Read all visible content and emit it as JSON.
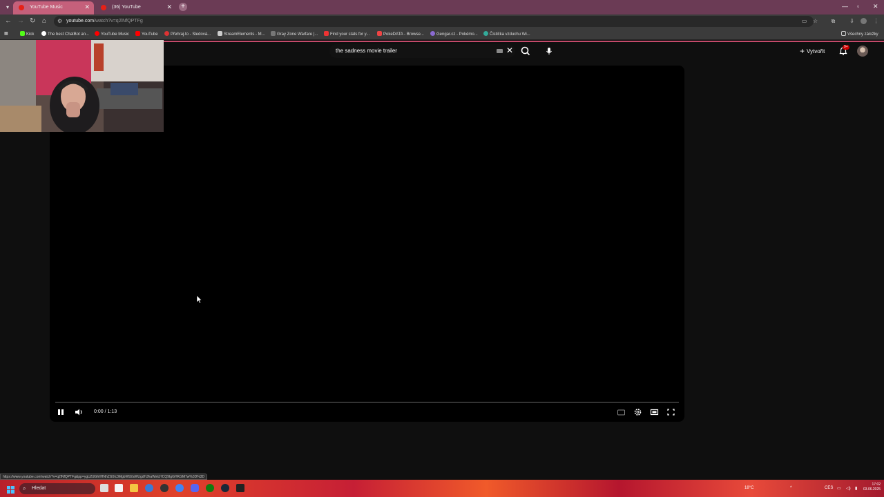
{
  "browser": {
    "tabs": [
      {
        "title": "YouTube Music",
        "active": true
      },
      {
        "title": "(36) YouTube",
        "active": false
      }
    ],
    "url_host": "youtube.com",
    "url_path": "/watch?v=q2lNfQPTFg",
    "bookmarks": [
      {
        "label": "Kick",
        "icon_color": "#53fc18"
      },
      {
        "label": "The best ChatBot an...",
        "icon_color": "#ffffff"
      },
      {
        "label": "YouTube Music",
        "icon_color": "#ff0000"
      },
      {
        "label": "YouTube",
        "icon_color": "#ff0000"
      },
      {
        "label": "Přehraj.to - Sledová...",
        "icon_color": "#d33"
      },
      {
        "label": "StreamElements - M...",
        "icon_color": "#cccccc"
      },
      {
        "label": "Gray Zone Warfare |...",
        "icon_color": "#777777"
      },
      {
        "label": "Find your stats for y...",
        "icon_color": "#e33"
      },
      {
        "label": "PokeDATA - Browse...",
        "icon_color": "#e44"
      },
      {
        "label": "Gengar.cz - Pokémo...",
        "icon_color": "#8a6ad0"
      },
      {
        "label": "Čistička vzduchu Wi...",
        "icon_color": "#3a9"
      }
    ],
    "all_bookmarks_label": "Všechny záložky"
  },
  "youtube": {
    "search_query": "the sadness movie trailer",
    "create_label": "Vytvořit",
    "notification_badge": "9+",
    "player": {
      "time": "0:00 / 1:13",
      "progress": 0.0,
      "state": "playing"
    }
  },
  "status_url": "https://www.youtube.com/watch?v=q2lNfQPTFg&pp=ygUZdGhlIHNhZG5lc3MgbW92aWUgdHJhaWxlcHCQ9IgGHKGM7w%3D%3D",
  "taskbar": {
    "search_placeholder": "Hledat",
    "language": "CES",
    "time": "17:02",
    "date": "03.06.2025",
    "weather": "18°C"
  },
  "colors": {
    "tab_active": "#c5607b",
    "tabbar": "#6b3b55",
    "youtube_red": "#ff0000",
    "accent_line": "#c44a6a"
  }
}
